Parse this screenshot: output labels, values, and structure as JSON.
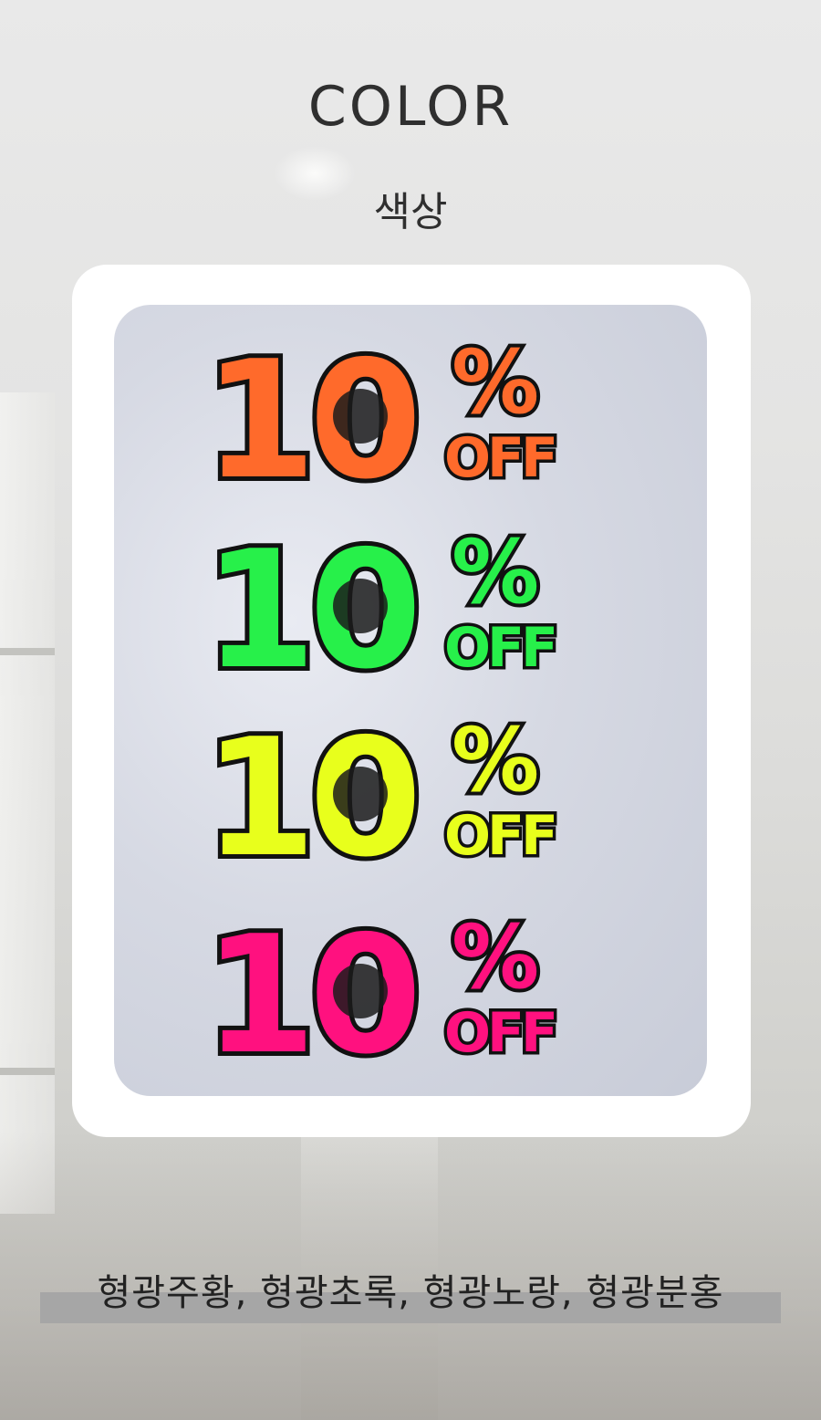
{
  "heading": {
    "en": "COLOR",
    "ko": "색상"
  },
  "product": {
    "stickers": [
      {
        "text": "10",
        "pct": "%",
        "off": "OFF",
        "color": "#ff6a2b"
      },
      {
        "text": "10",
        "pct": "%",
        "off": "OFF",
        "color": "#27f04a"
      },
      {
        "text": "10",
        "pct": "%",
        "off": "OFF",
        "color": "#e8ff1c"
      },
      {
        "text": "10",
        "pct": "%",
        "off": "OFF",
        "color": "#ff117f"
      }
    ]
  },
  "caption": "형광주황, 형광초록, 형광노랑, 형광분홍"
}
